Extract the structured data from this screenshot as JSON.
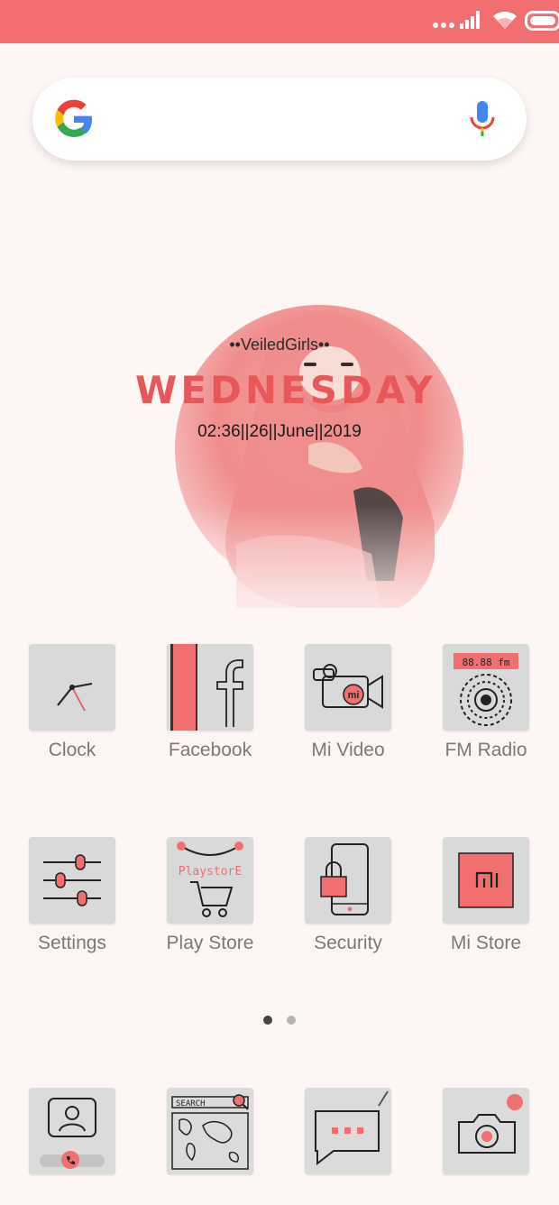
{
  "status_bar": {
    "bg": "#f16f71",
    "icons": [
      "more-dots-icon",
      "signal-icon",
      "wifi-icon",
      "battery-icon"
    ]
  },
  "search": {
    "logo": "google-icon",
    "voice": "mic-icon"
  },
  "widget": {
    "title": "••VeiledGirls••",
    "day": "WEDNESDAY",
    "datetime": "02:36||26||June||2019"
  },
  "apps_row1": [
    {
      "label": "Clock",
      "icon": "clock-icon"
    },
    {
      "label": "Facebook",
      "icon": "facebook-icon"
    },
    {
      "label": "Mi Video",
      "icon": "video-camera-icon"
    },
    {
      "label": "FM Radio",
      "icon": "radio-icon"
    }
  ],
  "apps_row2": [
    {
      "label": "Settings",
      "icon": "sliders-icon"
    },
    {
      "label": "Play Store",
      "icon": "shopping-cart-icon",
      "badge": "PlaystorE"
    },
    {
      "label": "Security",
      "icon": "lock-phone-icon"
    },
    {
      "label": "Mi Store",
      "icon": "mi-logo-icon"
    }
  ],
  "radio_display": "88.88 fm",
  "maps_search": "SEARCH",
  "pager": {
    "pages": 2,
    "active": 1
  },
  "dock": [
    {
      "icon": "phone-contact-icon"
    },
    {
      "icon": "map-search-icon"
    },
    {
      "icon": "message-icon"
    },
    {
      "icon": "camera-icon"
    }
  ],
  "colors": {
    "accent": "#f16f71",
    "tile": "#d9d9d9",
    "label": "#7a7a7a"
  }
}
